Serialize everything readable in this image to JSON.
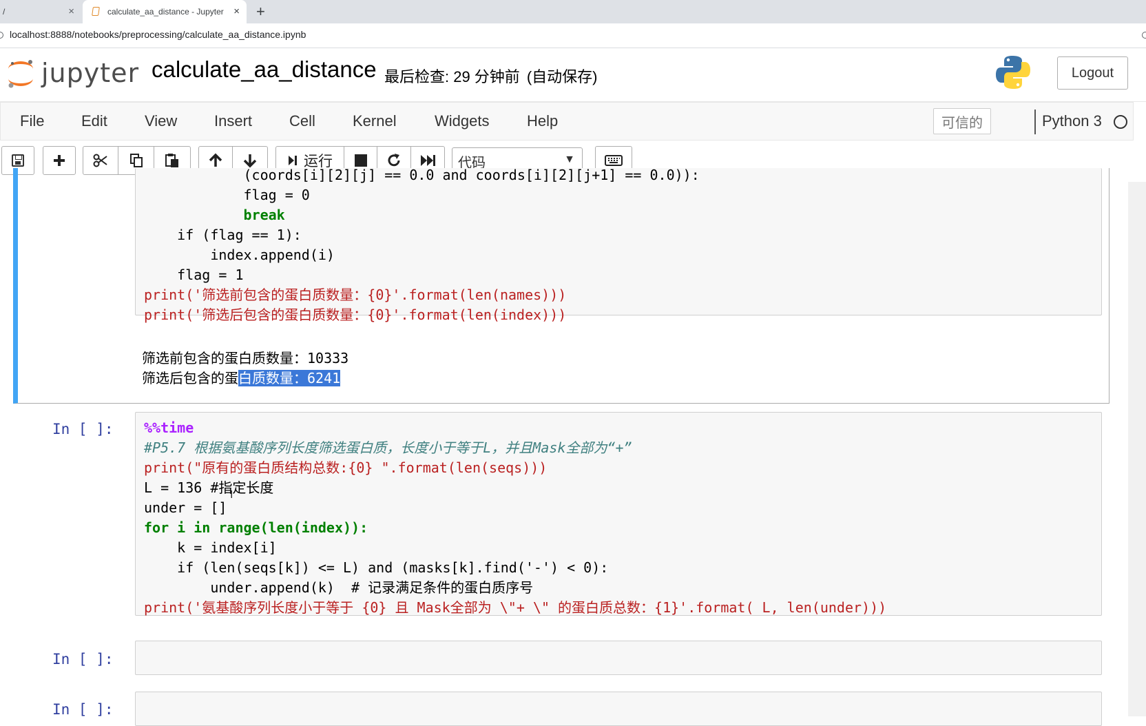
{
  "browser": {
    "tabs": [
      {
        "title": "/",
        "close": "×"
      },
      {
        "title": "calculate_aa_distance - Jupyter Notebook",
        "close": "×"
      }
    ],
    "new_tab": "+",
    "url": "localhost:8888/notebooks/preprocessing/calculate_aa_distance.ipynb"
  },
  "header": {
    "logo_text": "jupyter",
    "notebook_title": "calculate_aa_distance",
    "checkpoint": "最后检查: 29 分钟前",
    "autosave": "(自动保存)",
    "logout_label": "Logout"
  },
  "menubar": {
    "items": [
      "File",
      "Edit",
      "View",
      "Insert",
      "Cell",
      "Kernel",
      "Widgets",
      "Help"
    ],
    "trusted": "可信的",
    "kernel_name": "Python 3"
  },
  "toolbar": {
    "run_label": "运行",
    "cell_type": "代码",
    "icons": [
      "save-icon",
      "plus-icon",
      "cut-icon",
      "copy-icon",
      "paste-icon",
      "arrow-up-icon",
      "arrow-down-icon",
      "step-forward-icon",
      "stop-icon",
      "restart-icon",
      "fast-forward-icon",
      "keyboard-icon"
    ]
  },
  "cells": {
    "cell1": {
      "code_lines": [
        "            (coords[i][2][j] == 0.0 and coords[i][2][j+1] == 0.0)):",
        "            flag = 0",
        "            break",
        "    if (flag == 1):",
        "        index.append(i)",
        "    flag = 1",
        "print('筛选前包含的蛋白质数量：{0}'.format(len(names)))",
        "print('筛选后包含的蛋白质数量：{0}'.format(len(index)))"
      ],
      "output_lines": {
        "line1": "筛选前包含的蛋白质数量：10333",
        "line2_plain": "筛选后包含的蛋",
        "line2_selected": "白质数量：6241"
      }
    },
    "cell2": {
      "prompt": "In [ ]:",
      "code_lines": [
        "%%time",
        "#P5.7 根据氨基酸序列长度筛选蛋白质，长度小于等于L，并且Mask全部为“+”",
        "print(\"原有的蛋白质结构总数:{0} \".format(len(seqs)))",
        "L = 136 #指定长度",
        "under = []",
        "for i in range(len(index)):",
        "    k = index[i]",
        "    if (len(seqs[k]) <= L) and (masks[k].find('-') < 0):",
        "        under.append(k)  # 记录满足条件的蛋白质序号",
        "print('氨基酸序列长度小于等于 {0} 且 Mask全部为 \\\"+ \\\" 的蛋白质总数：{1}'.format( L, len(under)))"
      ]
    },
    "cell3": {
      "prompt": "In [ ]:"
    },
    "cell4": {
      "prompt": "In [ ]:"
    }
  }
}
